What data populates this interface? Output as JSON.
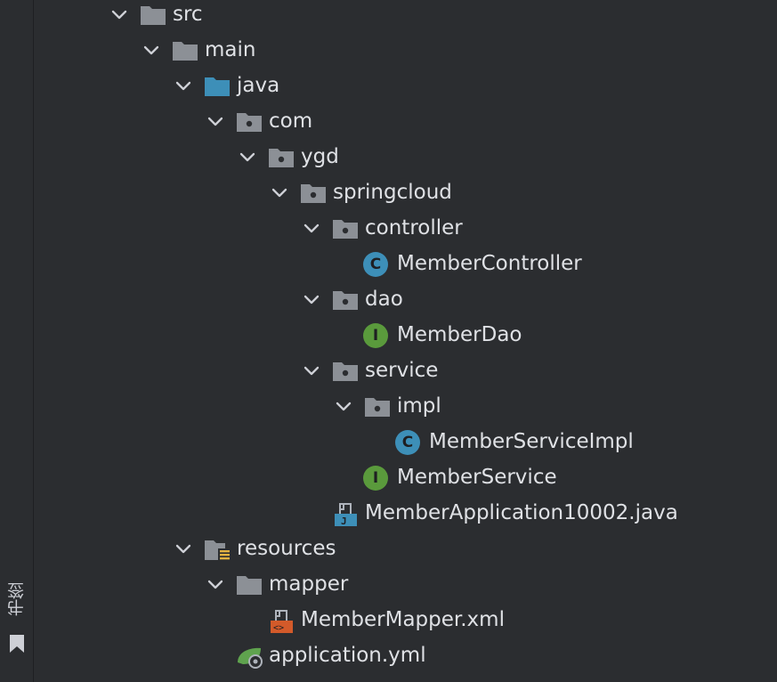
{
  "side_panel": {
    "bookmarks_label": "书签"
  },
  "tree": [
    {
      "label": "src",
      "type": "folder",
      "expanded": true
    },
    {
      "label": "main",
      "type": "folder",
      "expanded": true
    },
    {
      "label": "java",
      "type": "source-root",
      "expanded": true
    },
    {
      "label": "com",
      "type": "package",
      "expanded": true
    },
    {
      "label": "ygd",
      "type": "package",
      "expanded": true
    },
    {
      "label": "springcloud",
      "type": "package",
      "expanded": true
    },
    {
      "label": "controller",
      "type": "package",
      "expanded": true
    },
    {
      "label": "MemberController",
      "type": "class",
      "badge": "C"
    },
    {
      "label": "dao",
      "type": "package",
      "expanded": true
    },
    {
      "label": "MemberDao",
      "type": "interface",
      "badge": "I"
    },
    {
      "label": "service",
      "type": "package",
      "expanded": true
    },
    {
      "label": "impl",
      "type": "package",
      "expanded": true
    },
    {
      "label": "MemberServiceImpl",
      "type": "class",
      "badge": "C"
    },
    {
      "label": "MemberService",
      "type": "interface",
      "badge": "I"
    },
    {
      "label": "MemberApplication10002.java",
      "type": "java-file"
    },
    {
      "label": "resources",
      "type": "resources-root",
      "expanded": true
    },
    {
      "label": "mapper",
      "type": "folder",
      "expanded": true
    },
    {
      "label": "MemberMapper.xml",
      "type": "xml-file"
    },
    {
      "label": "application.yml",
      "type": "yml-file"
    }
  ],
  "colors": {
    "background": "#2b2d30",
    "text": "#dfe1e5",
    "folder": "#8c9096",
    "source_root": "#3d8fb8",
    "class_badge": "#3d8fb8",
    "interface_badge": "#5a9a3c",
    "xml": "#d35a2a",
    "spring": "#5fa34e"
  }
}
